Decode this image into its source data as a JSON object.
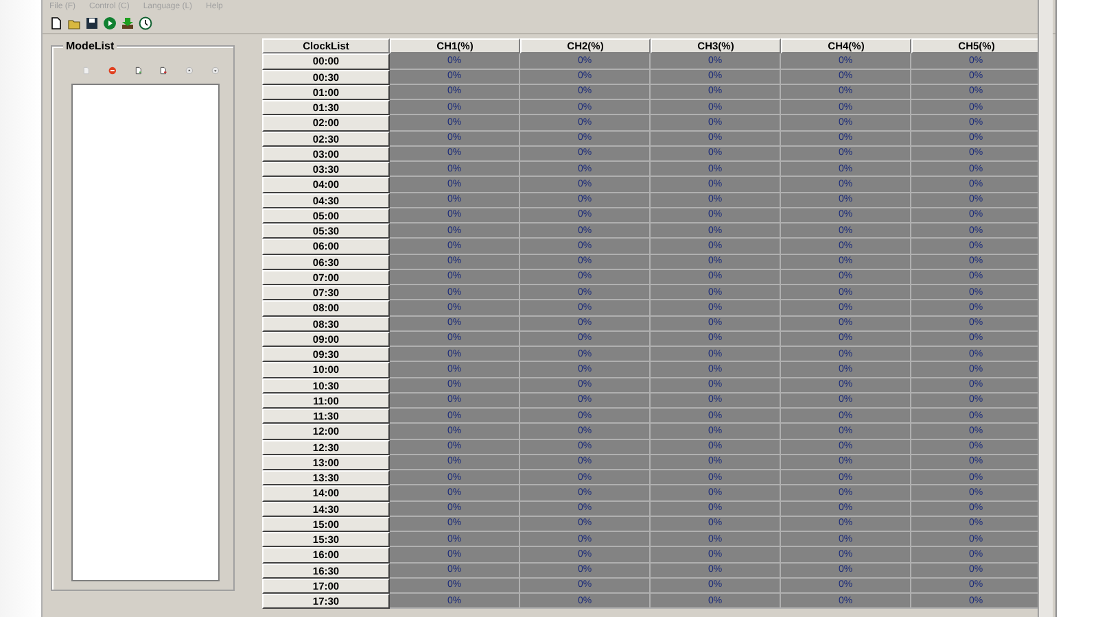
{
  "menu": [
    "File (F)",
    "Control (C)",
    "Language (L)",
    "Help"
  ],
  "modelist": {
    "title": "ModeList"
  },
  "table": {
    "columns": [
      "ClockList",
      "CH1(%)",
      "CH2(%)",
      "CH3(%)",
      "CH4(%)",
      "CH5(%)"
    ],
    "rows": [
      {
        "time": "00:00",
        "values": [
          "0%",
          "0%",
          "0%",
          "0%",
          "0%"
        ]
      },
      {
        "time": "00:30",
        "values": [
          "0%",
          "0%",
          "0%",
          "0%",
          "0%"
        ]
      },
      {
        "time": "01:00",
        "values": [
          "0%",
          "0%",
          "0%",
          "0%",
          "0%"
        ]
      },
      {
        "time": "01:30",
        "values": [
          "0%",
          "0%",
          "0%",
          "0%",
          "0%"
        ]
      },
      {
        "time": "02:00",
        "values": [
          "0%",
          "0%",
          "0%",
          "0%",
          "0%"
        ]
      },
      {
        "time": "02:30",
        "values": [
          "0%",
          "0%",
          "0%",
          "0%",
          "0%"
        ]
      },
      {
        "time": "03:00",
        "values": [
          "0%",
          "0%",
          "0%",
          "0%",
          "0%"
        ]
      },
      {
        "time": "03:30",
        "values": [
          "0%",
          "0%",
          "0%",
          "0%",
          "0%"
        ]
      },
      {
        "time": "04:00",
        "values": [
          "0%",
          "0%",
          "0%",
          "0%",
          "0%"
        ]
      },
      {
        "time": "04:30",
        "values": [
          "0%",
          "0%",
          "0%",
          "0%",
          "0%"
        ]
      },
      {
        "time": "05:00",
        "values": [
          "0%",
          "0%",
          "0%",
          "0%",
          "0%"
        ]
      },
      {
        "time": "05:30",
        "values": [
          "0%",
          "0%",
          "0%",
          "0%",
          "0%"
        ]
      },
      {
        "time": "06:00",
        "values": [
          "0%",
          "0%",
          "0%",
          "0%",
          "0%"
        ]
      },
      {
        "time": "06:30",
        "values": [
          "0%",
          "0%",
          "0%",
          "0%",
          "0%"
        ]
      },
      {
        "time": "07:00",
        "values": [
          "0%",
          "0%",
          "0%",
          "0%",
          "0%"
        ]
      },
      {
        "time": "07:30",
        "values": [
          "0%",
          "0%",
          "0%",
          "0%",
          "0%"
        ]
      },
      {
        "time": "08:00",
        "values": [
          "0%",
          "0%",
          "0%",
          "0%",
          "0%"
        ]
      },
      {
        "time": "08:30",
        "values": [
          "0%",
          "0%",
          "0%",
          "0%",
          "0%"
        ]
      },
      {
        "time": "09:00",
        "values": [
          "0%",
          "0%",
          "0%",
          "0%",
          "0%"
        ]
      },
      {
        "time": "09:30",
        "values": [
          "0%",
          "0%",
          "0%",
          "0%",
          "0%"
        ]
      },
      {
        "time": "10:00",
        "values": [
          "0%",
          "0%",
          "0%",
          "0%",
          "0%"
        ]
      },
      {
        "time": "10:30",
        "values": [
          "0%",
          "0%",
          "0%",
          "0%",
          "0%"
        ]
      },
      {
        "time": "11:00",
        "values": [
          "0%",
          "0%",
          "0%",
          "0%",
          "0%"
        ]
      },
      {
        "time": "11:30",
        "values": [
          "0%",
          "0%",
          "0%",
          "0%",
          "0%"
        ]
      },
      {
        "time": "12:00",
        "values": [
          "0%",
          "0%",
          "0%",
          "0%",
          "0%"
        ]
      },
      {
        "time": "12:30",
        "values": [
          "0%",
          "0%",
          "0%",
          "0%",
          "0%"
        ]
      },
      {
        "time": "13:00",
        "values": [
          "0%",
          "0%",
          "0%",
          "0%",
          "0%"
        ]
      },
      {
        "time": "13:30",
        "values": [
          "0%",
          "0%",
          "0%",
          "0%",
          "0%"
        ]
      },
      {
        "time": "14:00",
        "values": [
          "0%",
          "0%",
          "0%",
          "0%",
          "0%"
        ]
      },
      {
        "time": "14:30",
        "values": [
          "0%",
          "0%",
          "0%",
          "0%",
          "0%"
        ]
      },
      {
        "time": "15:00",
        "values": [
          "0%",
          "0%",
          "0%",
          "0%",
          "0%"
        ]
      },
      {
        "time": "15:30",
        "values": [
          "0%",
          "0%",
          "0%",
          "0%",
          "0%"
        ]
      },
      {
        "time": "16:00",
        "values": [
          "0%",
          "0%",
          "0%",
          "0%",
          "0%"
        ]
      },
      {
        "time": "16:30",
        "values": [
          "0%",
          "0%",
          "0%",
          "0%",
          "0%"
        ]
      },
      {
        "time": "17:00",
        "values": [
          "0%",
          "0%",
          "0%",
          "0%",
          "0%"
        ]
      },
      {
        "time": "17:30",
        "values": [
          "0%",
          "0%",
          "0%",
          "0%",
          "0%"
        ]
      }
    ]
  }
}
